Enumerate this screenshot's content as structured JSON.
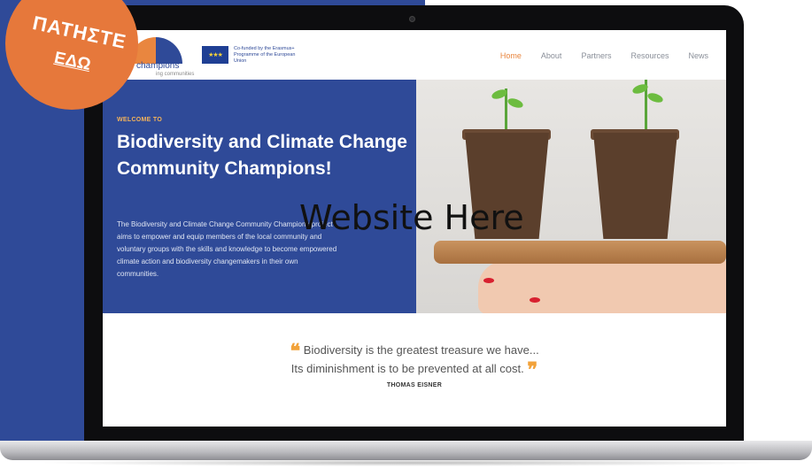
{
  "badge": {
    "line1": "ΠΑΤΗΣΤΕ",
    "line2": "ΕΔΩ"
  },
  "site": {
    "logo_text": "champions",
    "logo_sub": "ing communities",
    "eu_text": "Co-funded by the Erasmus+ Programme of the European Union",
    "nav": [
      "Home",
      "About",
      "Partners",
      "Resources",
      "News"
    ]
  },
  "hero": {
    "welcome": "WELCOME TO",
    "title": "Biodiversity and Climate Change Community Champions!",
    "body": "The Biodiversity and Climate Change Community Champions project aims to empower and equip members of the local community and voluntary groups with the skills and knowledge to become empowered climate action and biodiversity changemakers in their own communities."
  },
  "overlay_text": "Website Here",
  "quote": {
    "open_mark": "❝",
    "line1": "Biodiversity is the greatest treasure we have...",
    "line2": "Its diminishment is to be prevented at all cost.",
    "close_mark": "❞",
    "author": "THOMAS EISNER"
  },
  "colors": {
    "accent": "#e9863f",
    "brand_blue": "#2f4a98"
  }
}
